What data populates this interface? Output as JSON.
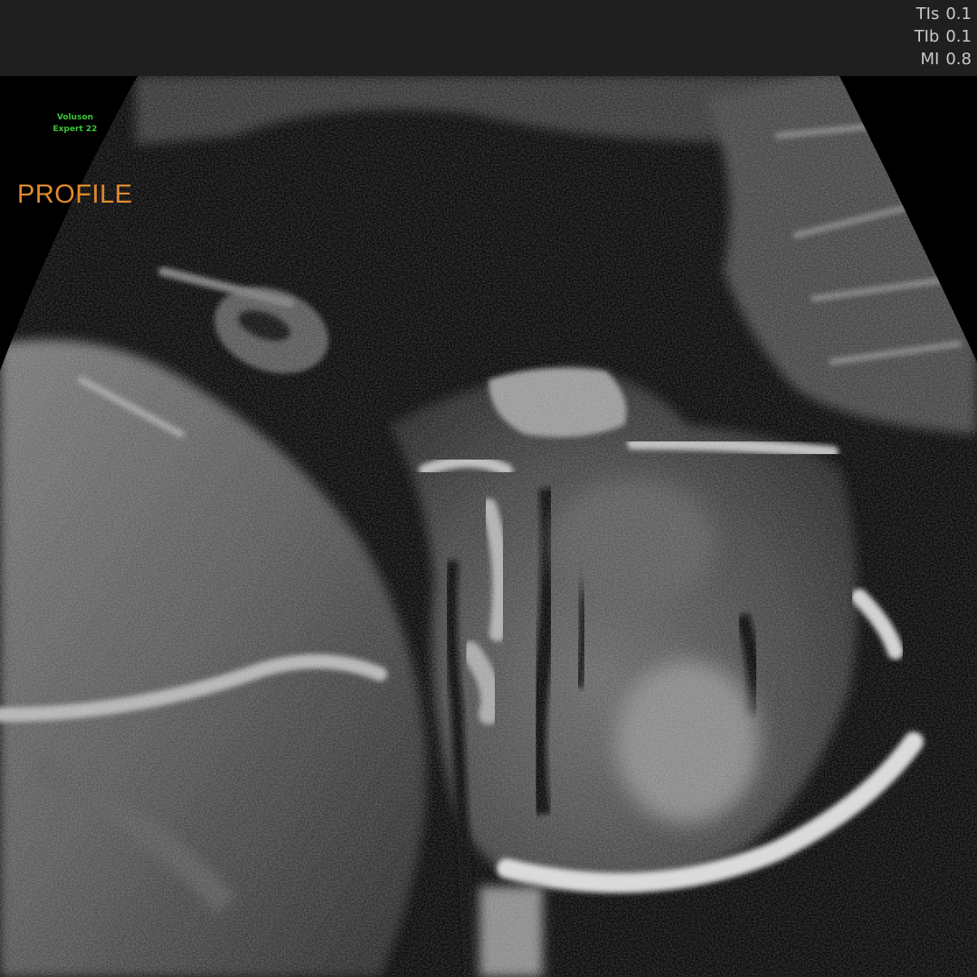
{
  "header": {
    "indices": [
      {
        "label": "TIs",
        "value": "0.1"
      },
      {
        "label": "TIb",
        "value": "0.1"
      },
      {
        "label": "MI",
        "value": "0.8"
      }
    ]
  },
  "brand": {
    "line1": "Voluson",
    "line2": "Expert 22",
    "color": "#37c837"
  },
  "annotation": {
    "label": "PROFILE",
    "color": "#e08a2c"
  },
  "image": {
    "subject": "fetal-profile-ultrasound",
    "mode": "grayscale"
  }
}
